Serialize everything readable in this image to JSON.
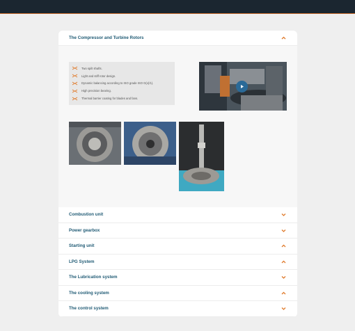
{
  "accordion": {
    "open_section": {
      "title": "The Compressor and Turbine Rotors",
      "features": [
        "Two spilt shafts.",
        "Light and stiff rotor design.",
        "Dynamic balancing according to ISO grade ISO G(x)/1).",
        "High precision bearing.",
        "Thermal barrier coating for blades and fans."
      ],
      "video": {
        "icon": "play-icon"
      },
      "photos": [
        "compressor-housing-photo",
        "turbine-wheel-photo",
        "rotor-shaft-photo"
      ]
    },
    "sections": [
      {
        "title": "Combustion unit",
        "chevron": "down"
      },
      {
        "title": "Power gearbox",
        "chevron": "down"
      },
      {
        "title": "Starting unit",
        "chevron": "up"
      },
      {
        "title": "LPG System",
        "chevron": "up"
      },
      {
        "title": "The Lubrication system",
        "chevron": "down"
      },
      {
        "title": "The cooling system",
        "chevron": "up"
      },
      {
        "title": "The control system",
        "chevron": "down"
      }
    ]
  },
  "colors": {
    "accent": "#e07b2c",
    "title": "#1f5a74",
    "topbar": "#1b2630"
  }
}
